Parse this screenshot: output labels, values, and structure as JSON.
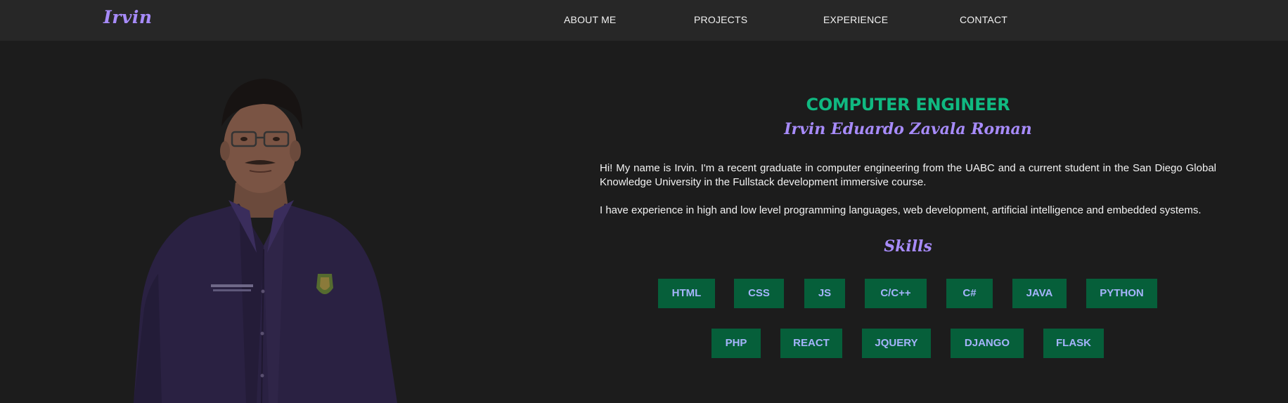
{
  "nav": {
    "logo": "Irvin",
    "links": [
      {
        "label": "ABOUT ME"
      },
      {
        "label": "PROJECTS"
      },
      {
        "label": "EXPERIENCE"
      },
      {
        "label": "CONTACT"
      }
    ]
  },
  "hero": {
    "role": "COMPUTER ENGINEER",
    "name": "Irvin Eduardo Zavala Roman",
    "bio": [
      "Hi! My name is Irvin. I'm a recent graduate in computer engineering from the UABC and a current student in the San Diego Global Knowledge University in the Fullstack development immersive course.",
      "I have experience in high and low level programming languages, web development, artificial intelligence and embedded systems."
    ],
    "skills_title": "Skills",
    "skills_row1": [
      "HTML",
      "CSS",
      "JS",
      "C/C++",
      "C#",
      "JAVA",
      "PYTHON"
    ],
    "skills_row2": [
      "PHP",
      "REACT",
      "JQUERY",
      "DJANGO",
      "FLASK"
    ]
  },
  "colors": {
    "background": "#1c1c1c",
    "navbar": "#272727",
    "accent_purple": "#a78bfa",
    "accent_green": "#10b981",
    "skill_bg": "#065f3a",
    "skill_text": "#a5b4fc"
  },
  "icons": {
    "photo": "profile-photo"
  }
}
